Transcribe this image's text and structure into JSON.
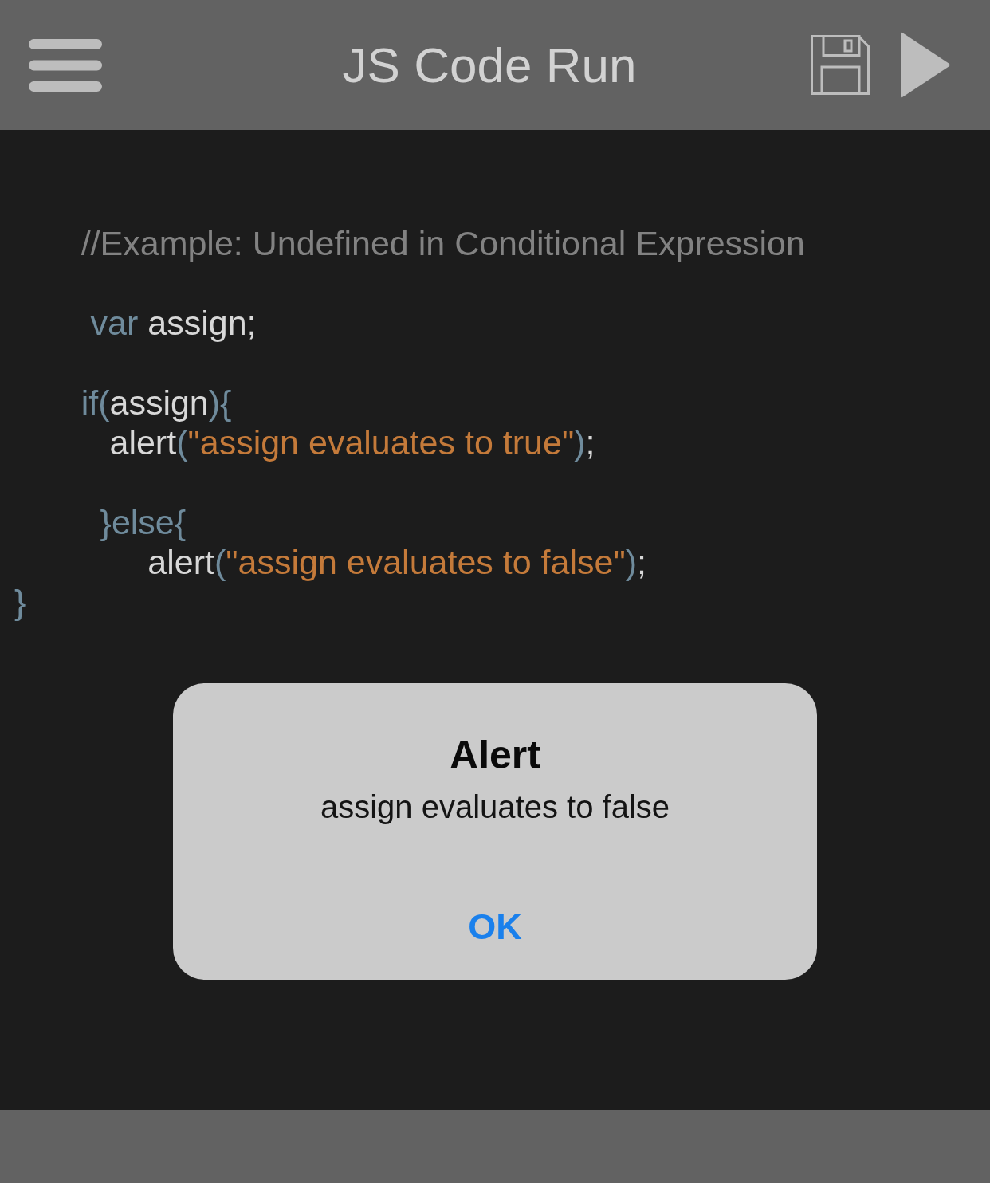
{
  "app_bar": {
    "title": "JS Code Run"
  },
  "editor": {
    "blocks": [
      [
        {
          "tokens": [
            {
              "kind": "comment",
              "text": "       //Example: Undefined in Conditional Expression"
            }
          ]
        }
      ],
      [
        {
          "tokens": [
            {
              "kind": "keyword",
              "text": "        var"
            },
            {
              "kind": "plain",
              "text": " assign;"
            }
          ]
        }
      ],
      [
        {
          "tokens": [
            {
              "kind": "keyword",
              "text": "       if"
            },
            {
              "kind": "punct",
              "text": "("
            },
            {
              "kind": "plain",
              "text": "assign"
            },
            {
              "kind": "punct",
              "text": "){"
            }
          ]
        },
        {
          "tokens": [
            {
              "kind": "plain",
              "text": "          alert"
            },
            {
              "kind": "punct",
              "text": "("
            },
            {
              "kind": "string",
              "text": "\"assign evaluates to true\""
            },
            {
              "kind": "punct",
              "text": ")"
            },
            {
              "kind": "plain",
              "text": ";"
            }
          ]
        }
      ],
      [
        {
          "tokens": [
            {
              "kind": "punct",
              "text": "         }"
            },
            {
              "kind": "keyword",
              "text": "else"
            },
            {
              "kind": "punct",
              "text": "{"
            }
          ]
        },
        {
          "tokens": [
            {
              "kind": "plain",
              "text": "              alert"
            },
            {
              "kind": "punct",
              "text": "("
            },
            {
              "kind": "string",
              "text": "\"assign evaluates to false\""
            },
            {
              "kind": "punct",
              "text": ")"
            },
            {
              "kind": "plain",
              "text": ";"
            }
          ]
        },
        {
          "tokens": [
            {
              "kind": "punct",
              "text": "}"
            }
          ]
        }
      ]
    ]
  },
  "alert": {
    "title": "Alert",
    "message": "assign evaluates to false",
    "buttons": [
      "OK"
    ]
  }
}
